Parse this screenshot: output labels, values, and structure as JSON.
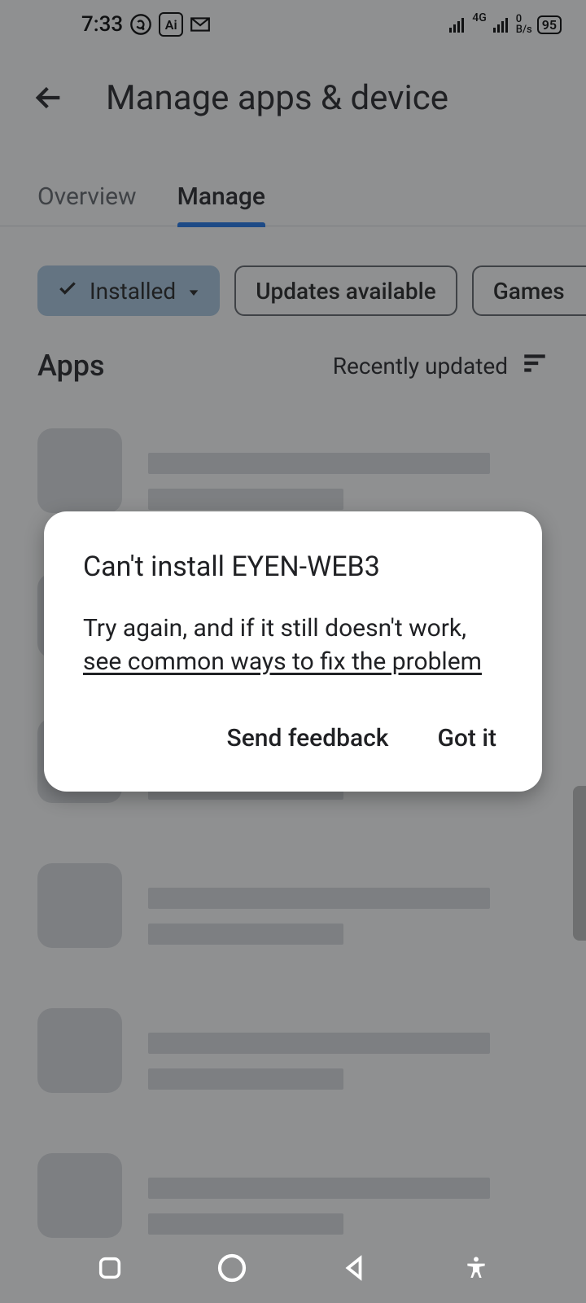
{
  "statusBar": {
    "time": "7:33",
    "network": "4G",
    "dataRate": "0 B/s",
    "battery": "95"
  },
  "header": {
    "title": "Manage apps & device"
  },
  "tabs": {
    "overview": "Overview",
    "manage": "Manage"
  },
  "chips": {
    "installed": "Installed",
    "updates": "Updates available",
    "games": "Games"
  },
  "list": {
    "heading": "Apps",
    "sortLabel": "Recently updated"
  },
  "dialog": {
    "title": "Can't install EYEN-WEB3",
    "bodyPrefix": "Try again, and if it still doesn't work, ",
    "bodyLink": "see common ways to fix the problem",
    "actions": {
      "feedback": "Send feedback",
      "gotIt": "Got it"
    }
  }
}
